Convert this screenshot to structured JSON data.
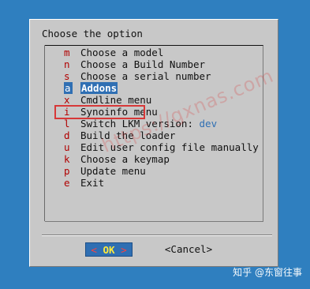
{
  "dialog": {
    "title": "Choose the option",
    "menu": [
      {
        "key": "m",
        "label": "Choose a model"
      },
      {
        "key": "n",
        "label": "Choose a Build Number"
      },
      {
        "key": "s",
        "label": "Choose a serial number"
      },
      {
        "key": "a",
        "label": "Addons",
        "selected": true
      },
      {
        "key": "x",
        "label": "Cmdline menu"
      },
      {
        "key": "i",
        "label": "Synoinfo menu"
      },
      {
        "key": "l",
        "label": "Switch LKM version:",
        "value": "dev"
      },
      {
        "key": "d",
        "label": "Build the loader"
      },
      {
        "key": "u",
        "label": "Edit user config file manually"
      },
      {
        "key": "k",
        "label": "Choose a keymap"
      },
      {
        "key": "p",
        "label": "Update menu"
      },
      {
        "key": "e",
        "label": "Exit"
      }
    ],
    "buttons": {
      "ok": {
        "left": "<",
        "label": "OK",
        "right": ">"
      },
      "cancel": "<Cancel>"
    }
  },
  "watermark": "https://gxnas.com",
  "footer": "知乎 @东窗往事",
  "colors": {
    "background": "#2f7fbf",
    "dialog": "#c8c8c8",
    "hotkey": "#b00000",
    "selection": "#2f6fb3",
    "annotation": "#d73838",
    "ok_text": "#ffeb3b"
  }
}
